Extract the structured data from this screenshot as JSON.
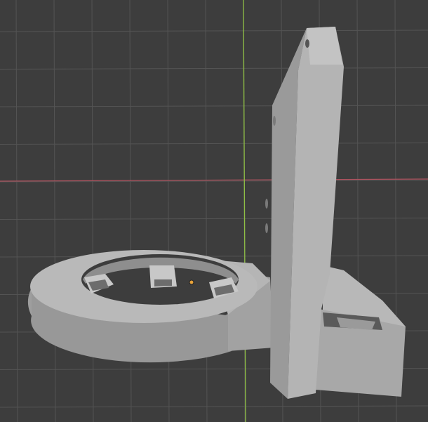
{
  "viewport": {
    "mode": "3D viewport",
    "background_color": "#3d3d3d",
    "grid_color": "#545454",
    "x_axis_color": "#b05460",
    "y_axis_color": "#8fbf45",
    "model_color": "#a6a6a6",
    "origin_color": "#e8a33a"
  }
}
